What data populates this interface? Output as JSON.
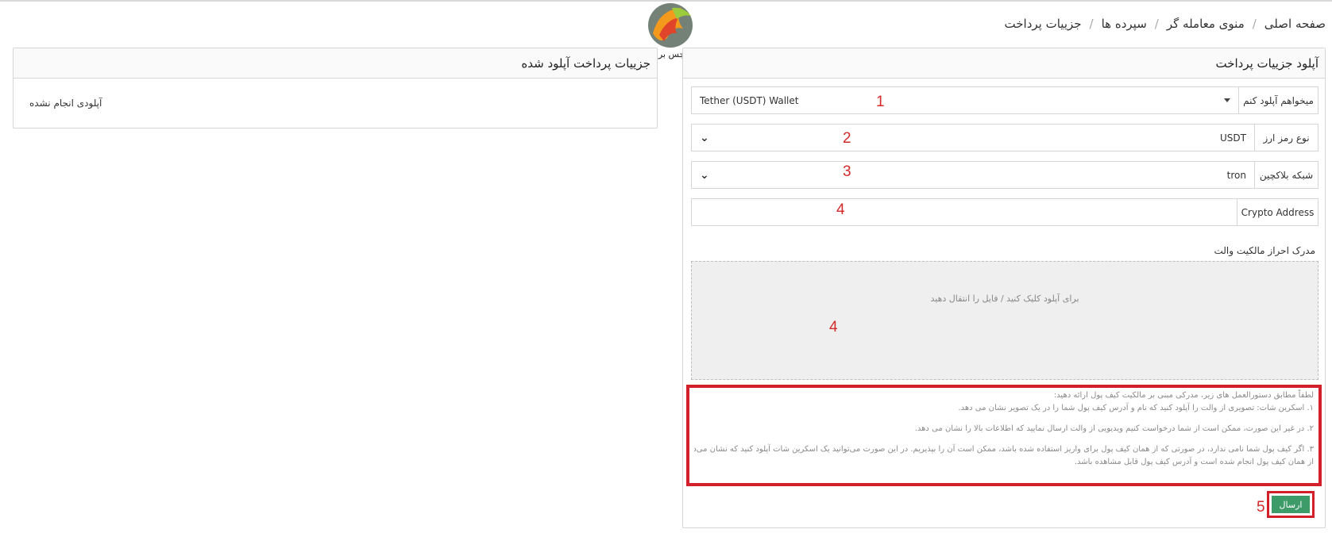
{
  "breadcrumb": {
    "items": [
      "صفحه اصلی",
      "منوی معامله گر",
      "سپرده ها",
      "جزییات پرداخت"
    ],
    "separator": "/"
  },
  "logo": {
    "text": "سجس بروکر"
  },
  "left_panel": {
    "title": "جزییات پرداخت آپلود شده",
    "empty_text": "آپلودی انجام نشده"
  },
  "right_panel": {
    "title": "آپلود جزییات پرداخت",
    "fields": {
      "upload_type": {
        "label": "میخواهم آپلود کنم",
        "value": "Tether (USDT) Wallet",
        "marker": "1"
      },
      "currency": {
        "label": "نوع رمز ارز",
        "value": "USDT",
        "marker": "2"
      },
      "network": {
        "label": "شبکه بلاکچین",
        "value": "tron",
        "marker": "3"
      },
      "address": {
        "label": "Crypto Address",
        "value": "",
        "marker": "4"
      }
    },
    "proof_label": "مدرک احراز مالکیت والت",
    "dropzone_text": "برای آپلود کلیک کنید / فایل را انتقال دهید",
    "dropzone_marker": "4",
    "instructions": {
      "intro": "لطفاً مطابق دستورالعمل های زیر، مدرکی مبنی بر مالکیت کیف پول ارائه دهید:",
      "line1": "۱. اسکرین شات: تصویری از والت را آپلود کنید که نام و آدرس کیف پول شما را در یک تصویر نشان می دهد.",
      "line2": "۲. در غیر این صورت، ممکن است از شما درخواست کنیم ویدیویی از والت ارسال نمایید که اطلاعات بالا را نشان می دهد.",
      "line3": "۳. اگر کیف پول شما نامی ندارد، در صورتی که از همان کیف پول برای واریز استفاده شده باشد، ممکن است آن را بپذیریم. در این صورت می‌توانید یک اسکرین شات آپلود کنید که نشان می‌دهد واریزی به ما",
      "line4": "از همان کیف پول انجام شده است و آدرس کیف پول قابل مشاهده باشد."
    },
    "submit_label": "ارسال",
    "submit_marker": "5"
  },
  "colors": {
    "highlight": "#d21f2a",
    "submit": "#3d9b6a",
    "marker": "#d42a2a"
  }
}
